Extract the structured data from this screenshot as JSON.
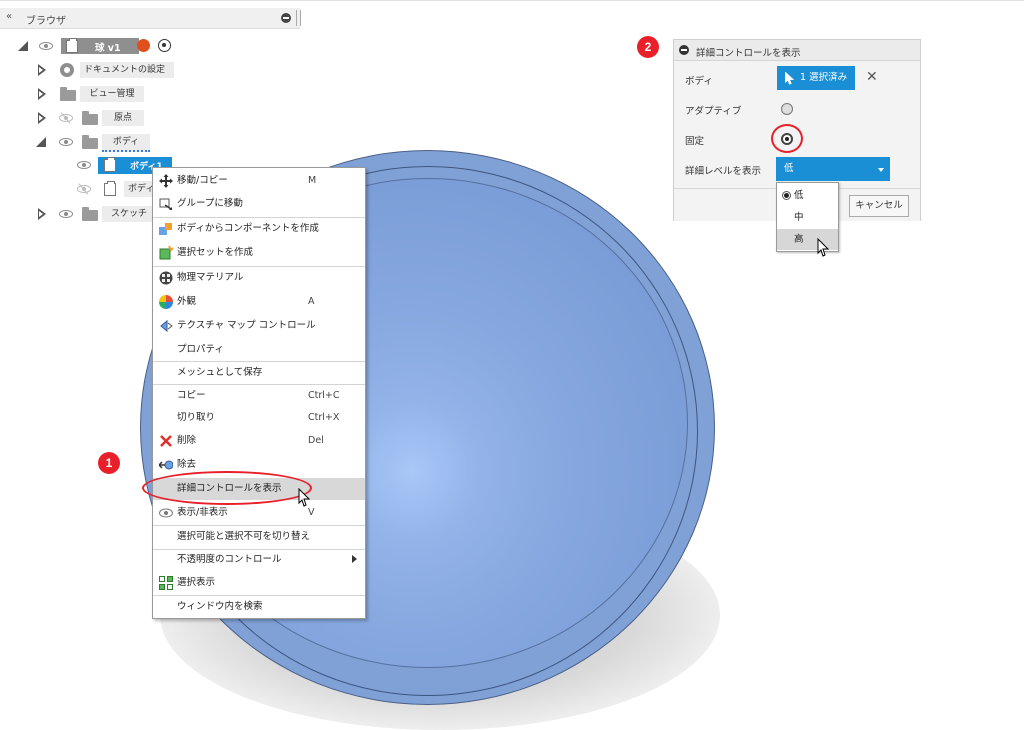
{
  "browser": {
    "title": "ブラウザ",
    "collapse_icon": "«",
    "tree": {
      "root": "球 v1",
      "items": [
        {
          "label": "ドキュメントの設定"
        },
        {
          "label": "ビュー管理"
        },
        {
          "label": "原点"
        },
        {
          "label": "ボディ"
        },
        {
          "label": "ボディ1"
        },
        {
          "label": "ボディ"
        },
        {
          "label": "スケッチ"
        }
      ]
    }
  },
  "context_menu": {
    "items": [
      {
        "label": "移動/コピー",
        "shortcut": "M",
        "icon": "move-icon"
      },
      {
        "label": "グループに移動",
        "shortcut": "",
        "icon": "group-move-icon"
      },
      {
        "label": "ボディからコンポーネントを作成",
        "shortcut": "",
        "icon": "component-from-body-icon"
      },
      {
        "label": "選択セットを作成",
        "shortcut": "",
        "icon": "selection-set-icon"
      },
      {
        "label": "物理マテリアル",
        "shortcut": "",
        "icon": "physical-material-icon"
      },
      {
        "label": "外観",
        "shortcut": "A",
        "icon": "appearance-icon"
      },
      {
        "label": "テクスチャ マップ コントロール",
        "shortcut": "",
        "icon": "texture-map-icon"
      },
      {
        "label": "プロパティ",
        "shortcut": "",
        "icon": ""
      },
      {
        "label": "メッシュとして保存",
        "shortcut": "",
        "icon": ""
      },
      {
        "label": "コピー",
        "shortcut": "Ctrl+C",
        "icon": ""
      },
      {
        "label": "切り取り",
        "shortcut": "Ctrl+X",
        "icon": ""
      },
      {
        "label": "削除",
        "shortcut": "Del",
        "icon": "delete-icon"
      },
      {
        "label": "除去",
        "shortcut": "",
        "icon": "remove-icon"
      },
      {
        "label": "詳細コントロールを表示",
        "shortcut": "",
        "icon": ""
      },
      {
        "label": "表示/非表示",
        "shortcut": "V",
        "icon": "eye-icon"
      },
      {
        "label": "選択可能と選択不可を切り替え",
        "shortcut": "",
        "icon": ""
      },
      {
        "label": "不透明度のコントロール",
        "shortcut": "",
        "icon": ""
      },
      {
        "label": "選択表示",
        "shortcut": "",
        "icon": "isolate-icon"
      },
      {
        "label": "ウィンドウ内を検索",
        "shortcut": "",
        "icon": ""
      }
    ]
  },
  "dialog": {
    "title": "詳細コントロールを表示",
    "body_label": "ボディ",
    "selection_button": "1 選択済み",
    "adaptive_label": "アダプティブ",
    "fixed_label": "固定",
    "lod_label": "詳細レベルを表示",
    "lod_value": "低",
    "cancel": "キャンセル",
    "lod_options": [
      "低",
      "中",
      "高"
    ]
  },
  "callouts": [
    "1",
    "2"
  ],
  "colors": {
    "accent": "#1b8fd6",
    "callout": "#e8202a",
    "model": "#7fa1d6"
  }
}
